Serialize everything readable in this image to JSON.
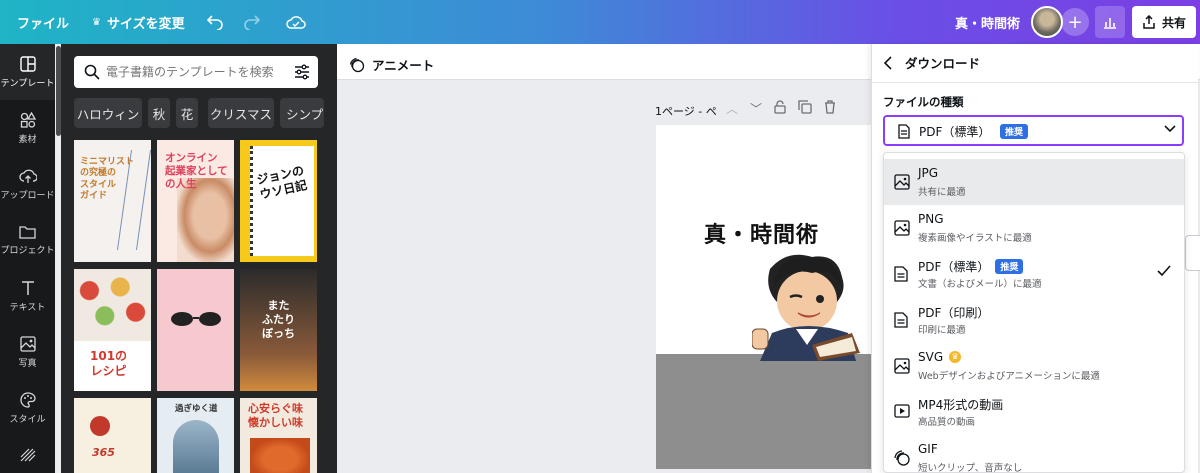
{
  "topbar": {
    "file": "ファイル",
    "resize": "サイズを変更",
    "design_title": "真・時間術",
    "share": "共有"
  },
  "rail": {
    "items": [
      {
        "label": "テンプレート",
        "icon": "template-icon"
      },
      {
        "label": "素材",
        "icon": "elements-icon"
      },
      {
        "label": "アップロード",
        "icon": "upload-icon"
      },
      {
        "label": "プロジェクト",
        "icon": "folder-icon"
      },
      {
        "label": "テキスト",
        "icon": "text-icon"
      },
      {
        "label": "写真",
        "icon": "photo-icon"
      },
      {
        "label": "スタイル",
        "icon": "palette-icon"
      }
    ]
  },
  "panel": {
    "search_placeholder": "電子書籍のテンプレートを検索",
    "chips": [
      "ハロウィン",
      "秋",
      "花",
      "クリスマス",
      "シンプル"
    ],
    "thumbs": [
      {
        "text": "ミニマリスト\nの究極の\nスタイル\nガイド"
      },
      {
        "text": "オンライン\n起業家として\nの人生"
      },
      {
        "text": "ジョンの\nウソ日記"
      },
      {
        "text": "101の\nレシピ"
      },
      {
        "text": ""
      },
      {
        "text": "また\nふたり\nぼっち"
      },
      {
        "text": "365"
      },
      {
        "text": "過ぎゆく道"
      },
      {
        "text": "心安らぐ味\n懐かしい味"
      }
    ]
  },
  "editor": {
    "animate": "アニメート",
    "page_label": "1ページ - ペ",
    "page_title": "真・時間術"
  },
  "download": {
    "title": "ダウンロード",
    "file_type_label": "ファイルの種類",
    "selected": "PDF（標準）",
    "recommended": "推奨",
    "options": [
      {
        "name": "JPG",
        "desc": "共有に最適",
        "icon": "image-icon"
      },
      {
        "name": "PNG",
        "desc": "複素画像やイラストに最適",
        "icon": "image-icon"
      },
      {
        "name": "PDF（標準）",
        "desc": "文書（およびメール）に最適",
        "icon": "document-icon",
        "badge": "推奨"
      },
      {
        "name": "PDF（印刷）",
        "desc": "印刷に最適",
        "icon": "document-icon"
      },
      {
        "name": "SVG",
        "desc": "Webデザインおよびアニメーションに最適",
        "icon": "image-icon"
      },
      {
        "name": "MP4形式の動画",
        "desc": "高品質の動画",
        "icon": "video-icon"
      },
      {
        "name": "GIF",
        "desc": "短いクリップ、音声なし",
        "icon": "gif-icon"
      }
    ]
  },
  "colors": {
    "accent": "#8b3dff",
    "badge": "#2f6fe4",
    "rail": "#18191b",
    "panel": "#252627"
  }
}
